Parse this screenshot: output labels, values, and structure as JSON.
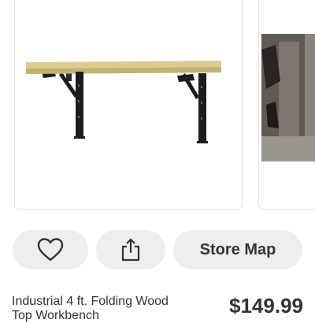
{
  "product": {
    "title": "Industrial 4 ft. Folding Wood Top Workbench",
    "price": "$149.99"
  },
  "actions": {
    "favorite_icon": "heart-icon",
    "share_icon": "share-icon",
    "store_map_label": "Store Map"
  },
  "gallery": {
    "main_image": "workbench-product-photo",
    "next_image": "workbench-lifestyle-photo"
  },
  "colors": {
    "pill_background": "#eeeeee",
    "text": "#333333",
    "wood_top": "#dccc8f",
    "metal": "#1c1c1c"
  }
}
